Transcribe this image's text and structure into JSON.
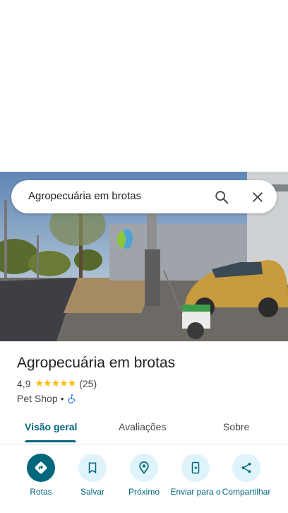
{
  "search": {
    "query": "Agropecuária em brotas"
  },
  "place": {
    "name": "Agropecuária em brotas",
    "rating": "4,9",
    "stars": "★★★★★",
    "review_count": "(25)",
    "category": "Pet Shop",
    "separator": "•"
  },
  "tabs": [
    {
      "label": "Visão geral",
      "active": true
    },
    {
      "label": "Avaliações",
      "active": false
    },
    {
      "label": "Sobre",
      "active": false
    }
  ],
  "actions": [
    {
      "label": "Rotas",
      "icon": "directions-icon"
    },
    {
      "label": "Salvar",
      "icon": "bookmark-icon"
    },
    {
      "label": "Próximo",
      "icon": "nearby-icon"
    },
    {
      "label": "Enviar para o",
      "icon": "send-to-phone-icon"
    },
    {
      "label": "Compartilhar",
      "icon": "share-icon"
    }
  ],
  "colors": {
    "accent": "#00677d",
    "star": "#fbbc04",
    "chip": "#dff3fb"
  }
}
